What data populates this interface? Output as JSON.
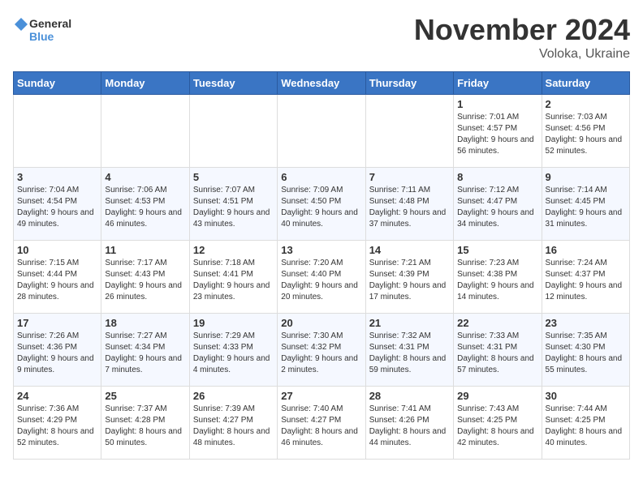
{
  "logo": {
    "general": "General",
    "blue": "Blue"
  },
  "header": {
    "month": "November 2024",
    "location": "Voloka, Ukraine"
  },
  "weekdays": [
    "Sunday",
    "Monday",
    "Tuesday",
    "Wednesday",
    "Thursday",
    "Friday",
    "Saturday"
  ],
  "weeks": [
    [
      {
        "day": "",
        "sunrise": "",
        "sunset": "",
        "daylight": ""
      },
      {
        "day": "",
        "sunrise": "",
        "sunset": "",
        "daylight": ""
      },
      {
        "day": "",
        "sunrise": "",
        "sunset": "",
        "daylight": ""
      },
      {
        "day": "",
        "sunrise": "",
        "sunset": "",
        "daylight": ""
      },
      {
        "day": "",
        "sunrise": "",
        "sunset": "",
        "daylight": ""
      },
      {
        "day": "1",
        "sunrise": "Sunrise: 7:01 AM",
        "sunset": "Sunset: 4:57 PM",
        "daylight": "Daylight: 9 hours and 56 minutes."
      },
      {
        "day": "2",
        "sunrise": "Sunrise: 7:03 AM",
        "sunset": "Sunset: 4:56 PM",
        "daylight": "Daylight: 9 hours and 52 minutes."
      }
    ],
    [
      {
        "day": "3",
        "sunrise": "Sunrise: 7:04 AM",
        "sunset": "Sunset: 4:54 PM",
        "daylight": "Daylight: 9 hours and 49 minutes."
      },
      {
        "day": "4",
        "sunrise": "Sunrise: 7:06 AM",
        "sunset": "Sunset: 4:53 PM",
        "daylight": "Daylight: 9 hours and 46 minutes."
      },
      {
        "day": "5",
        "sunrise": "Sunrise: 7:07 AM",
        "sunset": "Sunset: 4:51 PM",
        "daylight": "Daylight: 9 hours and 43 minutes."
      },
      {
        "day": "6",
        "sunrise": "Sunrise: 7:09 AM",
        "sunset": "Sunset: 4:50 PM",
        "daylight": "Daylight: 9 hours and 40 minutes."
      },
      {
        "day": "7",
        "sunrise": "Sunrise: 7:11 AM",
        "sunset": "Sunset: 4:48 PM",
        "daylight": "Daylight: 9 hours and 37 minutes."
      },
      {
        "day": "8",
        "sunrise": "Sunrise: 7:12 AM",
        "sunset": "Sunset: 4:47 PM",
        "daylight": "Daylight: 9 hours and 34 minutes."
      },
      {
        "day": "9",
        "sunrise": "Sunrise: 7:14 AM",
        "sunset": "Sunset: 4:45 PM",
        "daylight": "Daylight: 9 hours and 31 minutes."
      }
    ],
    [
      {
        "day": "10",
        "sunrise": "Sunrise: 7:15 AM",
        "sunset": "Sunset: 4:44 PM",
        "daylight": "Daylight: 9 hours and 28 minutes."
      },
      {
        "day": "11",
        "sunrise": "Sunrise: 7:17 AM",
        "sunset": "Sunset: 4:43 PM",
        "daylight": "Daylight: 9 hours and 26 minutes."
      },
      {
        "day": "12",
        "sunrise": "Sunrise: 7:18 AM",
        "sunset": "Sunset: 4:41 PM",
        "daylight": "Daylight: 9 hours and 23 minutes."
      },
      {
        "day": "13",
        "sunrise": "Sunrise: 7:20 AM",
        "sunset": "Sunset: 4:40 PM",
        "daylight": "Daylight: 9 hours and 20 minutes."
      },
      {
        "day": "14",
        "sunrise": "Sunrise: 7:21 AM",
        "sunset": "Sunset: 4:39 PM",
        "daylight": "Daylight: 9 hours and 17 minutes."
      },
      {
        "day": "15",
        "sunrise": "Sunrise: 7:23 AM",
        "sunset": "Sunset: 4:38 PM",
        "daylight": "Daylight: 9 hours and 14 minutes."
      },
      {
        "day": "16",
        "sunrise": "Sunrise: 7:24 AM",
        "sunset": "Sunset: 4:37 PM",
        "daylight": "Daylight: 9 hours and 12 minutes."
      }
    ],
    [
      {
        "day": "17",
        "sunrise": "Sunrise: 7:26 AM",
        "sunset": "Sunset: 4:36 PM",
        "daylight": "Daylight: 9 hours and 9 minutes."
      },
      {
        "day": "18",
        "sunrise": "Sunrise: 7:27 AM",
        "sunset": "Sunset: 4:34 PM",
        "daylight": "Daylight: 9 hours and 7 minutes."
      },
      {
        "day": "19",
        "sunrise": "Sunrise: 7:29 AM",
        "sunset": "Sunset: 4:33 PM",
        "daylight": "Daylight: 9 hours and 4 minutes."
      },
      {
        "day": "20",
        "sunrise": "Sunrise: 7:30 AM",
        "sunset": "Sunset: 4:32 PM",
        "daylight": "Daylight: 9 hours and 2 minutes."
      },
      {
        "day": "21",
        "sunrise": "Sunrise: 7:32 AM",
        "sunset": "Sunset: 4:31 PM",
        "daylight": "Daylight: 8 hours and 59 minutes."
      },
      {
        "day": "22",
        "sunrise": "Sunrise: 7:33 AM",
        "sunset": "Sunset: 4:31 PM",
        "daylight": "Daylight: 8 hours and 57 minutes."
      },
      {
        "day": "23",
        "sunrise": "Sunrise: 7:35 AM",
        "sunset": "Sunset: 4:30 PM",
        "daylight": "Daylight: 8 hours and 55 minutes."
      }
    ],
    [
      {
        "day": "24",
        "sunrise": "Sunrise: 7:36 AM",
        "sunset": "Sunset: 4:29 PM",
        "daylight": "Daylight: 8 hours and 52 minutes."
      },
      {
        "day": "25",
        "sunrise": "Sunrise: 7:37 AM",
        "sunset": "Sunset: 4:28 PM",
        "daylight": "Daylight: 8 hours and 50 minutes."
      },
      {
        "day": "26",
        "sunrise": "Sunrise: 7:39 AM",
        "sunset": "Sunset: 4:27 PM",
        "daylight": "Daylight: 8 hours and 48 minutes."
      },
      {
        "day": "27",
        "sunrise": "Sunrise: 7:40 AM",
        "sunset": "Sunset: 4:27 PM",
        "daylight": "Daylight: 8 hours and 46 minutes."
      },
      {
        "day": "28",
        "sunrise": "Sunrise: 7:41 AM",
        "sunset": "Sunset: 4:26 PM",
        "daylight": "Daylight: 8 hours and 44 minutes."
      },
      {
        "day": "29",
        "sunrise": "Sunrise: 7:43 AM",
        "sunset": "Sunset: 4:25 PM",
        "daylight": "Daylight: 8 hours and 42 minutes."
      },
      {
        "day": "30",
        "sunrise": "Sunrise: 7:44 AM",
        "sunset": "Sunset: 4:25 PM",
        "daylight": "Daylight: 8 hours and 40 minutes."
      }
    ]
  ]
}
